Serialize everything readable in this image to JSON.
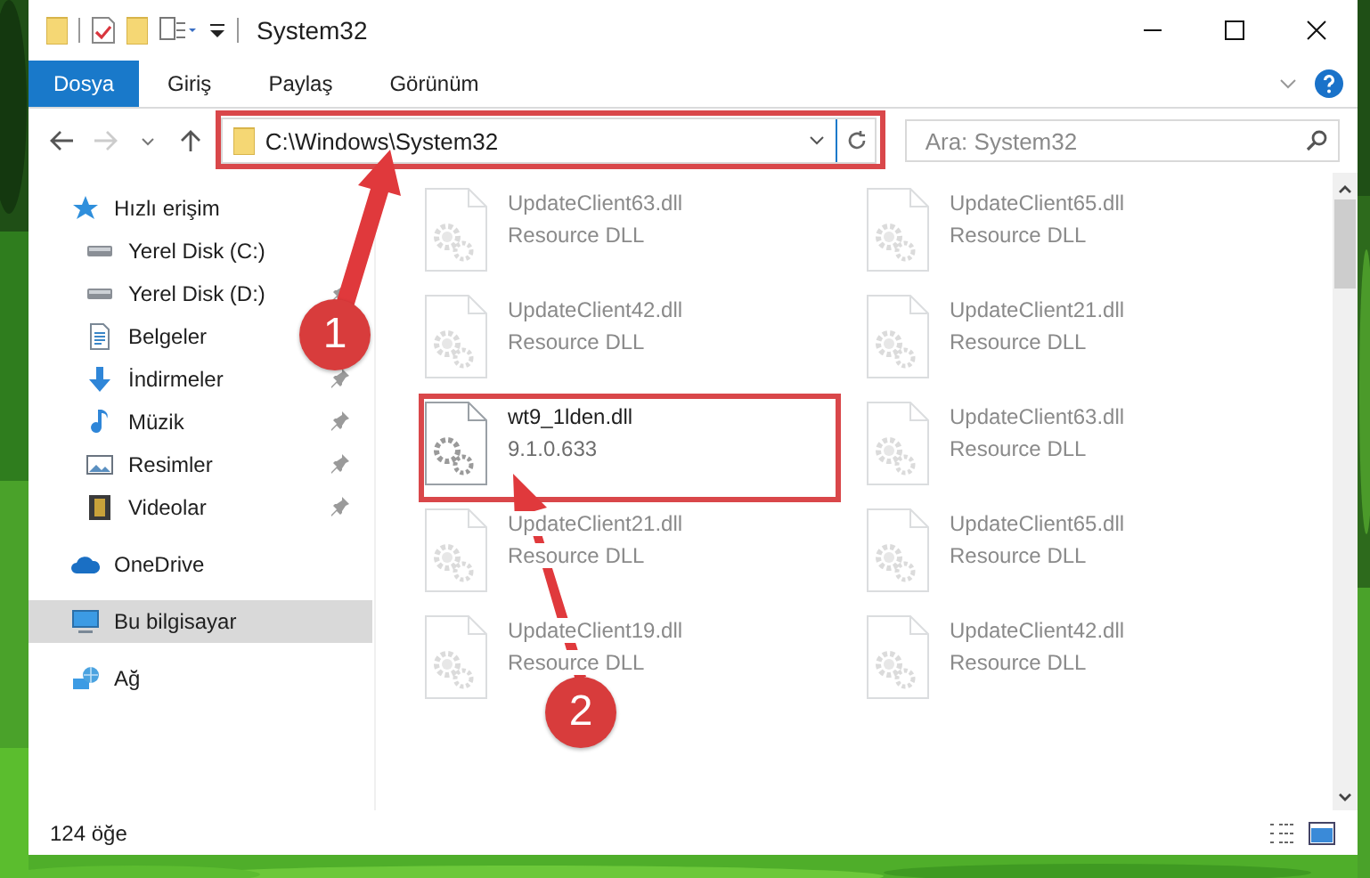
{
  "window": {
    "title": "System32"
  },
  "ribbon_tabs": [
    {
      "label": "Dosya",
      "selected": true
    },
    {
      "label": "Giriş",
      "selected": false
    },
    {
      "label": "Paylaş",
      "selected": false
    },
    {
      "label": "Görünüm",
      "selected": false
    }
  ],
  "address": {
    "value": "C:\\Windows\\System32"
  },
  "search": {
    "placeholder": "Ara: System32"
  },
  "sidebar": {
    "items": [
      {
        "label": "Hızlı erişim",
        "kind": "star",
        "selected": false,
        "children": [
          {
            "label": "Yerel Disk (C:)",
            "kind": "drive",
            "selected": false,
            "pinned": false
          },
          {
            "label": "Yerel Disk (D:)",
            "kind": "drive",
            "selected": false,
            "pinned": true
          },
          {
            "label": "Belgeler",
            "kind": "document",
            "selected": false,
            "pinned": false
          },
          {
            "label": "İndirmeler",
            "kind": "download",
            "selected": false,
            "pinned": true
          },
          {
            "label": "Müzik",
            "kind": "music",
            "selected": false,
            "pinned": true
          },
          {
            "label": "Resimler",
            "kind": "pictures",
            "selected": false,
            "pinned": true
          },
          {
            "label": "Videolar",
            "kind": "videos",
            "selected": false,
            "pinned": true
          }
        ]
      },
      {
        "label": "OneDrive",
        "kind": "cloud",
        "selected": false
      },
      {
        "label": "Bu bilgisayar",
        "kind": "computer",
        "selected": true
      },
      {
        "label": "Ağ",
        "kind": "network",
        "selected": false
      }
    ]
  },
  "files": [
    {
      "name": "UpdateClient63.dll",
      "detail": "Resource DLL",
      "faded": true
    },
    {
      "name": "UpdateClient65.dll",
      "detail": "Resource DLL",
      "faded": true
    },
    {
      "name": "UpdateClient42.dll",
      "detail": "Resource DLL",
      "faded": true
    },
    {
      "name": "UpdateClient21.dll",
      "detail": "Resource DLL",
      "faded": true
    },
    {
      "name": "wt9_1lden.dll",
      "detail": "9.1.0.633",
      "faded": false
    },
    {
      "name": "UpdateClient63.dll",
      "detail": "Resource DLL",
      "faded": true
    },
    {
      "name": "UpdateClient21.dll",
      "detail": "Resource DLL",
      "faded": true
    },
    {
      "name": "UpdateClient65.dll",
      "detail": "Resource DLL",
      "faded": true
    },
    {
      "name": "UpdateClient19.dll",
      "detail": "Resource DLL",
      "faded": true
    },
    {
      "name": "UpdateClient42.dll",
      "detail": "Resource DLL",
      "faded": true
    }
  ],
  "status_bar": {
    "count": "124 öğe"
  },
  "annotations": [
    {
      "label": "1"
    },
    {
      "label": "2"
    }
  ]
}
